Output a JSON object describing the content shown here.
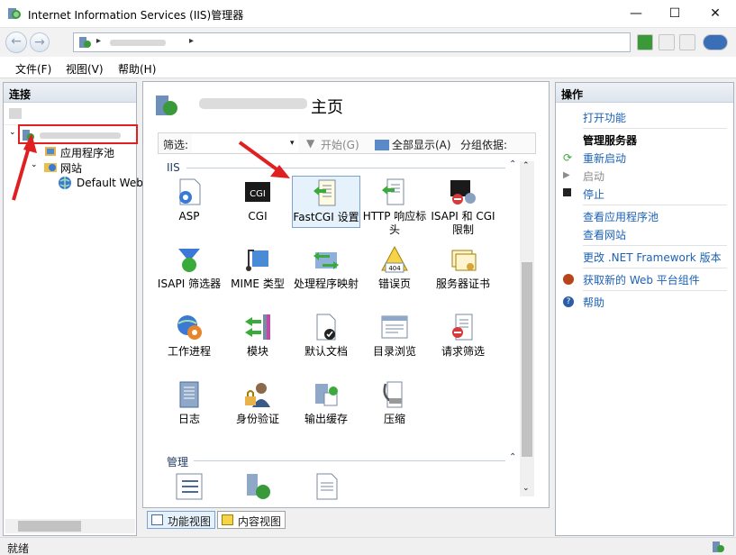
{
  "window": {
    "title": "Internet Information Services (IIS)管理器",
    "minimize": "—",
    "maximize": "☐",
    "close": "✕"
  },
  "address": {
    "back": "←",
    "forward": "→",
    "separator": "▸"
  },
  "menu": {
    "items": [
      "文件(F)",
      "视图(V)",
      "帮助(H)"
    ]
  },
  "connections": {
    "header": "连接",
    "tree": [
      {
        "label": "应用程序池"
      },
      {
        "label": "网站"
      },
      {
        "label": "Default Web"
      }
    ]
  },
  "center": {
    "title": "主页",
    "filter": {
      "label": "筛选:",
      "start": "开始(G)",
      "show_all": "全部显示(A)",
      "group_by": "分组依据:"
    },
    "groups": {
      "iis": "IIS",
      "manage": "管理"
    },
    "features": [
      {
        "label": "ASP"
      },
      {
        "label": "CGI"
      },
      {
        "label": "FastCGI 设置"
      },
      {
        "label": "HTTP 响应标头"
      },
      {
        "label": "ISAPI 和 CGI 限制"
      },
      {
        "label": "ISAPI 筛选器"
      },
      {
        "label": "MIME 类型"
      },
      {
        "label": "处理程序映射"
      },
      {
        "label": "错误页"
      },
      {
        "label": "服务器证书"
      },
      {
        "label": "工作进程"
      },
      {
        "label": "模块"
      },
      {
        "label": "默认文档"
      },
      {
        "label": "目录浏览"
      },
      {
        "label": "请求筛选"
      },
      {
        "label": "日志"
      },
      {
        "label": "身份验证"
      },
      {
        "label": "输出缓存"
      },
      {
        "label": "压缩"
      }
    ],
    "cgi_badge": "CGI",
    "error_badge": "404"
  },
  "views": {
    "features": "功能视图",
    "content": "内容视图"
  },
  "actions": {
    "header": "操作",
    "open_feature": "打开功能",
    "manage_server": "管理服务器",
    "restart": "重新启动",
    "start": "启动",
    "stop": "停止",
    "view_app_pools": "查看应用程序池",
    "view_sites": "查看网站",
    "change_net": "更改 .NET Framework 版本",
    "get_components": "获取新的 Web 平台组件",
    "help": "帮助"
  },
  "status": {
    "text": "就绪"
  }
}
